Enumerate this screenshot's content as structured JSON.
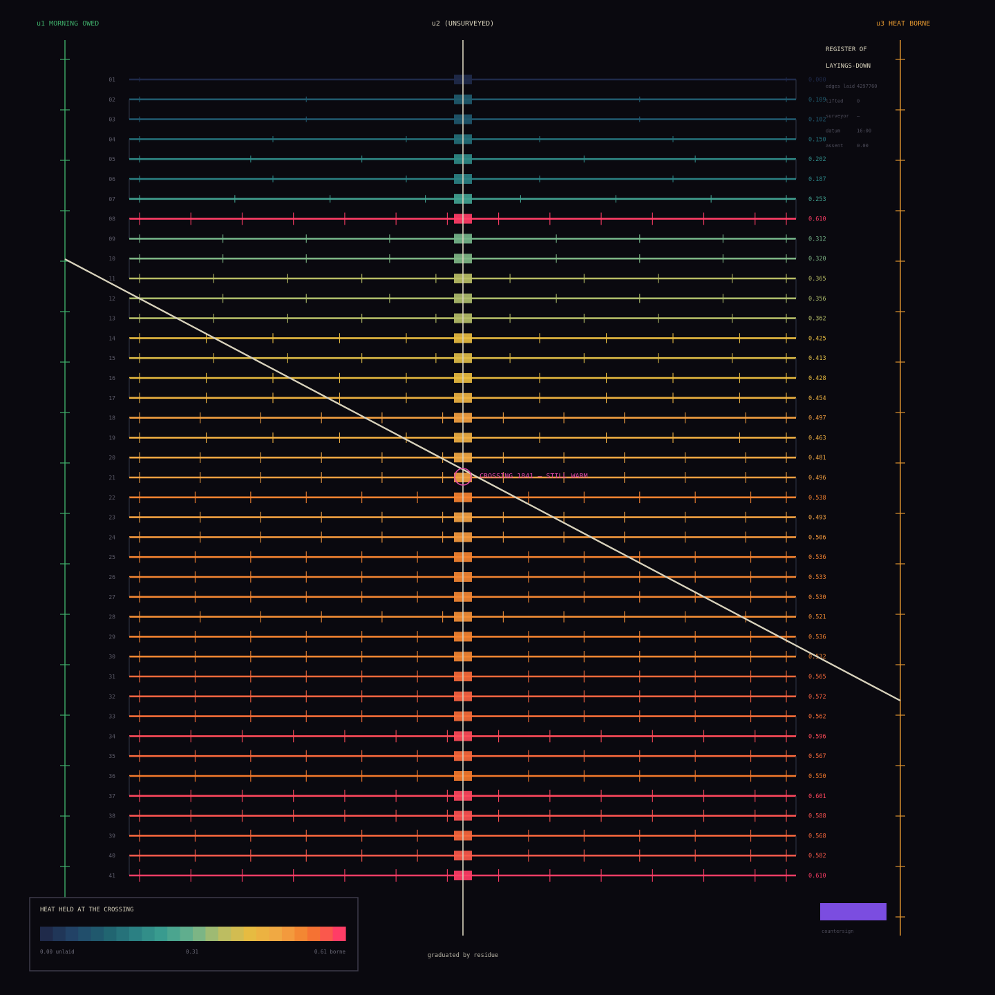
{
  "columns": {
    "u1": "u1 MORNING OWED",
    "u2": "u2 (UNSURVEYED)",
    "u3": "u3 HEAT BORNE"
  },
  "register": {
    "title_line1": "REGISTER OF",
    "title_line2": "LAYINGS-DOWN",
    "rows": [
      {
        "key": "edges laid",
        "value": "4297760"
      },
      {
        "key": "lifted",
        "value": "0"
      },
      {
        "key": "surveyor",
        "value": "—"
      },
      {
        "key": "datum",
        "value": "16:00"
      },
      {
        "key": "assent",
        "value": "0.00"
      }
    ]
  },
  "layings": [
    {
      "id": "01",
      "value": "0.000"
    },
    {
      "id": "02",
      "value": "0.109"
    },
    {
      "id": "03",
      "value": "0.102"
    },
    {
      "id": "04",
      "value": "0.150"
    },
    {
      "id": "05",
      "value": "0.202"
    },
    {
      "id": "06",
      "value": "0.187"
    },
    {
      "id": "07",
      "value": "0.253"
    },
    {
      "id": "08",
      "value": "0.610"
    },
    {
      "id": "09",
      "value": "0.312"
    },
    {
      "id": "10",
      "value": "0.320"
    },
    {
      "id": "11",
      "value": "0.365"
    },
    {
      "id": "12",
      "value": "0.356"
    },
    {
      "id": "13",
      "value": "0.362"
    },
    {
      "id": "14",
      "value": "0.425"
    },
    {
      "id": "15",
      "value": "0.413"
    },
    {
      "id": "16",
      "value": "0.428"
    },
    {
      "id": "17",
      "value": "0.454"
    },
    {
      "id": "18",
      "value": "0.497"
    },
    {
      "id": "19",
      "value": "0.463"
    },
    {
      "id": "20",
      "value": "0.481"
    },
    {
      "id": "21",
      "value": "0.496"
    },
    {
      "id": "22",
      "value": "0.538"
    },
    {
      "id": "23",
      "value": "0.493"
    },
    {
      "id": "24",
      "value": "0.506"
    },
    {
      "id": "25",
      "value": "0.536"
    },
    {
      "id": "26",
      "value": "0.533"
    },
    {
      "id": "27",
      "value": "0.530"
    },
    {
      "id": "28",
      "value": "0.521"
    },
    {
      "id": "29",
      "value": "0.536"
    },
    {
      "id": "30",
      "value": "0.532"
    },
    {
      "id": "31",
      "value": "0.565"
    },
    {
      "id": "32",
      "value": "0.572"
    },
    {
      "id": "33",
      "value": "0.562"
    },
    {
      "id": "34",
      "value": "0.596"
    },
    {
      "id": "35",
      "value": "0.567"
    },
    {
      "id": "36",
      "value": "0.550"
    },
    {
      "id": "37",
      "value": "0.601"
    },
    {
      "id": "38",
      "value": "0.588"
    },
    {
      "id": "39",
      "value": "0.568"
    },
    {
      "id": "40",
      "value": "0.582"
    },
    {
      "id": "41",
      "value": "0.610"
    }
  ],
  "crossing": {
    "label": "CROSSING 1841 — STILL WARM",
    "row": "21",
    "color": "#e04aa8"
  },
  "legend": {
    "title": "HEAT HELD AT THE CROSSING",
    "min_label": "0.00 unlaid",
    "mid_label": "0.31",
    "max_label": "0.61 borne",
    "min": 0,
    "max": 0.61
  },
  "footer": "graduated by residue",
  "countersign": {
    "label": "countersign",
    "color": "#7b4de0"
  },
  "colors": {
    "background": "#0a090f",
    "u1": "#3fae6a",
    "u2": "#d8d2bc",
    "u3": "#e0952f",
    "diagonal": "#d8d2bc",
    "ramp": [
      "#1f2a4a",
      "#22466a",
      "#1f5f6e",
      "#2a7f82",
      "#3a9e90",
      "#6bb38e",
      "#b9bd64",
      "#e8bb3f",
      "#f2a544",
      "#f47a2b",
      "#ff3d66"
    ]
  }
}
